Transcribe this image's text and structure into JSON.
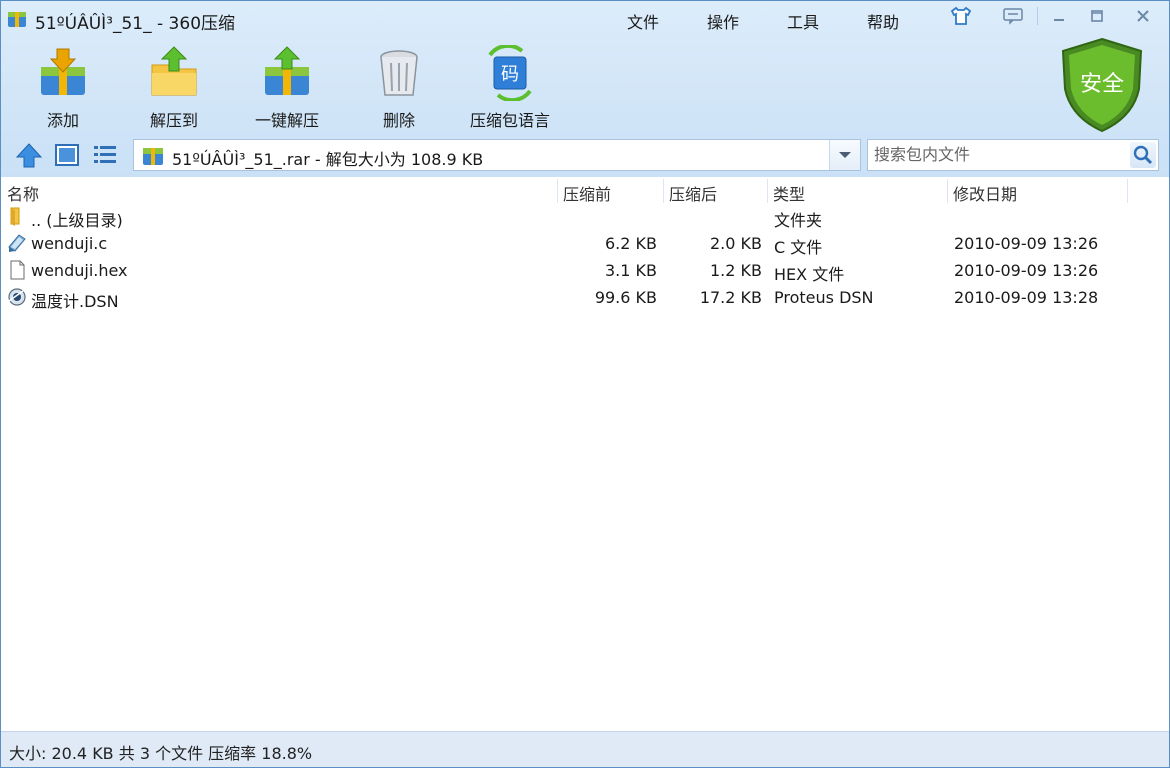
{
  "window": {
    "title": "51ºÚÂÛÌ³_51_ - 360压缩",
    "menu": [
      "文件",
      "操作",
      "工具",
      "帮助"
    ]
  },
  "toolbar": {
    "add_label": "添加",
    "extract_to_label": "解压到",
    "one_click_extract_label": "一键解压",
    "delete_label": "删除",
    "language_label": "压缩包语言",
    "language_icon_glyph": "码",
    "security_badge": "安全"
  },
  "address": {
    "path": "51ºÚÂÛÌ³_51_.rar - 解包大小为 108.9 KB"
  },
  "search": {
    "placeholder": "搜索包内文件"
  },
  "columns": {
    "name": "名称",
    "packed_before": "压缩前",
    "packed_after": "压缩后",
    "type": "类型",
    "modified": "修改日期"
  },
  "files": [
    {
      "icon": "folder-up-icon",
      "name": ".. (上级目录)",
      "size": "",
      "packed": "",
      "type": "文件夹",
      "modified": ""
    },
    {
      "icon": "c-source-file-icon",
      "name": "wenduji.c",
      "size": "6.2 KB",
      "packed": "2.0 KB",
      "type": "C 文件",
      "modified": "2010-09-09 13:26"
    },
    {
      "icon": "text-file-icon",
      "name": "wenduji.hex",
      "size": "3.1 KB",
      "packed": "1.2 KB",
      "type": "HEX 文件",
      "modified": "2010-09-09 13:26"
    },
    {
      "icon": "proteus-file-icon",
      "name": "温度计.DSN",
      "size": "99.6 KB",
      "packed": "17.2 KB",
      "type": "Proteus DSN",
      "modified": "2010-09-09 13:28"
    }
  ],
  "status": {
    "summary": "大小: 20.4 KB 共 3 个文件 压缩率 18.8%"
  },
  "colors": {
    "header_bg": "#d4e7f9",
    "shield_green": "#5aa02c",
    "accent_blue": "#3c7fd0"
  }
}
